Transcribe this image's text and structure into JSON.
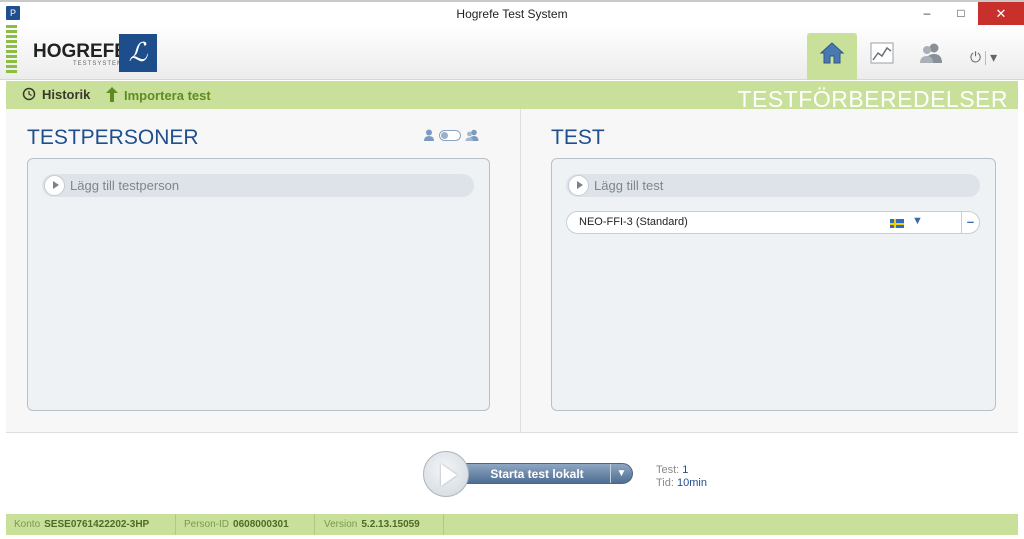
{
  "window": {
    "title": "Hogrefe Test System",
    "minimize": "–",
    "maximize": "□",
    "close": "✕"
  },
  "header": {
    "logo_text": "HOGREFE",
    "logo_sub": "TESTSYSTEM",
    "nav": [
      {
        "id": "home",
        "icon": "home-icon",
        "active": true
      },
      {
        "id": "reports",
        "icon": "chart-icon",
        "active": false
      },
      {
        "id": "persons",
        "icon": "users-icon",
        "active": false
      }
    ],
    "power_icon": "⏻",
    "power_caret": "▾"
  },
  "toolbar": {
    "history_label": "Historik",
    "import_label": "Importera test",
    "section_title": "TESTFÖRBEREDELSER"
  },
  "left_panel": {
    "title": "TESTPERSONER",
    "add_label": "Lägg till testperson"
  },
  "right_panel": {
    "title": "TEST",
    "add_label": "Lägg till test",
    "tests": [
      {
        "name": "NEO-FFI-3 (Standard)",
        "language": "sv",
        "caret": "▼",
        "remove": "–"
      }
    ]
  },
  "start": {
    "button_label": "Starta test lokalt",
    "caret": "▼",
    "test_key": "Test:",
    "test_value": "1",
    "time_key": "Tid:",
    "time_value": "10min"
  },
  "status": {
    "account_key": "Konto",
    "account_value": "SESE0761422202-3HP",
    "person_key": "Person-ID",
    "person_value": "0608000301",
    "version_key": "Version",
    "version_value": "5.2.13.15059"
  },
  "colors": {
    "accent_green": "#c9e09a",
    "brand_blue": "#1f4f8c",
    "close_red": "#c7302b"
  }
}
